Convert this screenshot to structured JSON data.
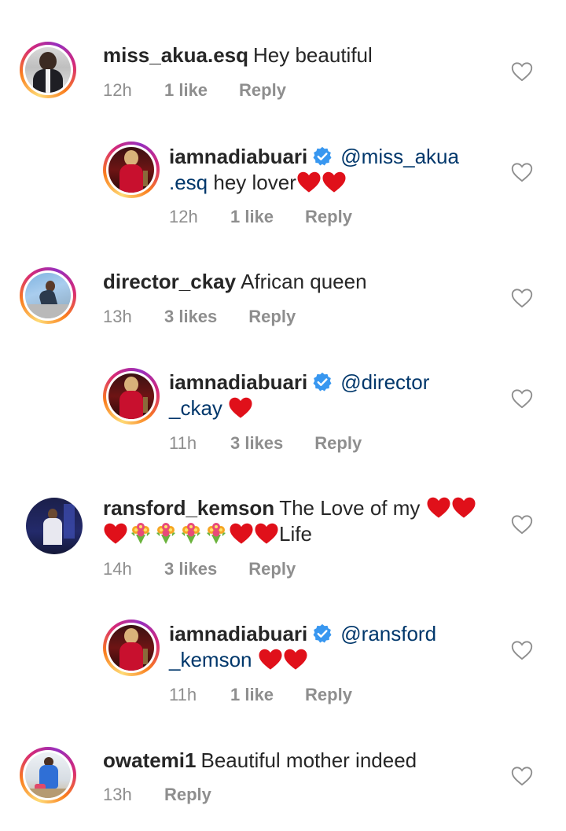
{
  "comments": [
    {
      "username": "miss_akua.esq",
      "text": "Hey beautiful",
      "time": "12h",
      "likes": "1 like",
      "reply": "Reply"
    },
    {
      "username": "iamnadiabuari",
      "mention": "@miss_akua",
      "mention2": ".esq",
      "text": "hey lover",
      "time": "12h",
      "likes": "1 like",
      "reply": "Reply"
    },
    {
      "username": "director_ckay",
      "text": "African queen",
      "time": "13h",
      "likes": "3 likes",
      "reply": "Reply"
    },
    {
      "username": "iamnadiabuari",
      "mention": "@director",
      "mention2": "_ckay",
      "time": "11h",
      "likes": "3 likes",
      "reply": "Reply"
    },
    {
      "username": "ransford_kemson",
      "text": "The Love of my",
      "text2": "Life",
      "time": "14h",
      "likes": "3 likes",
      "reply": "Reply"
    },
    {
      "username": "iamnadiabuari",
      "mention": "@ransford",
      "mention2": "_kemson",
      "time": "11h",
      "likes": "1 like",
      "reply": "Reply"
    },
    {
      "username": "owatemi1",
      "text": "Beautiful mother indeed",
      "time": "13h",
      "reply": "Reply"
    }
  ],
  "colors": {
    "username": "#262626",
    "mention": "#00376b",
    "meta": "#8e8e8e",
    "verified": "#3897f0",
    "heart_emoji": "#e0101a"
  },
  "icons": {
    "like": "heart-outline-icon",
    "verified": "verified-badge-icon"
  }
}
